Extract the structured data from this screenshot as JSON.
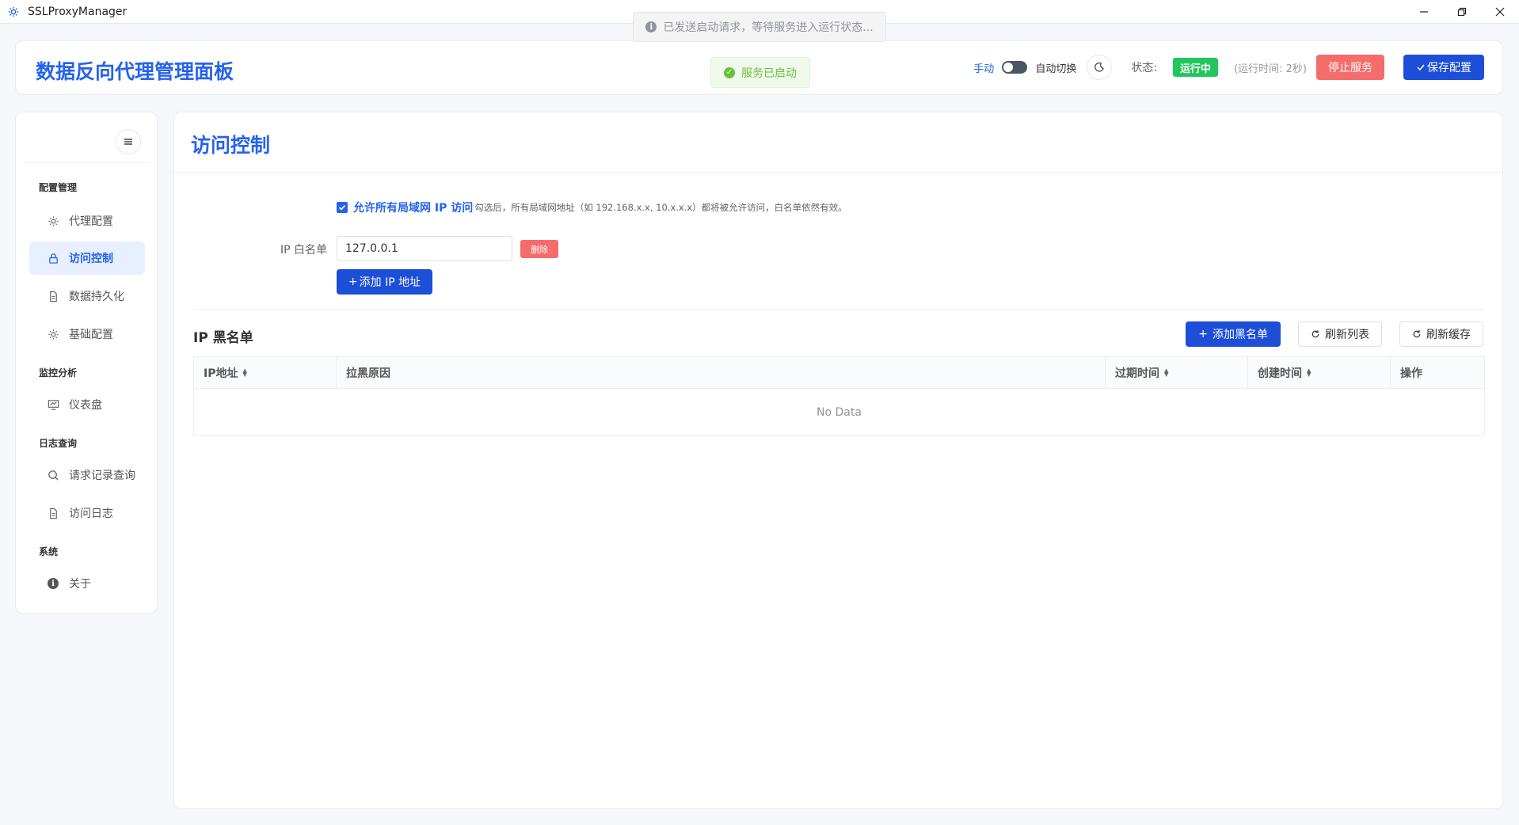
{
  "window": {
    "title": "SSLProxyManager",
    "icon": "gear-icon",
    "controls": [
      "minimize-icon",
      "restore-icon",
      "close-icon"
    ]
  },
  "toasts": {
    "info": "已发送启动请求，等待服务进入运行状态...",
    "success": "服务已启动"
  },
  "header": {
    "title": "数据反向代理管理面板",
    "mode_manual": "手动",
    "mode_auto": "自动切换",
    "status_label": "状态:",
    "status_value": "运行中",
    "uptime": "(运行时间: 2秒)",
    "stop_button": "停止服务",
    "save_button": "保存配置"
  },
  "sidebar": {
    "groups": [
      {
        "title": "配置管理",
        "items": [
          {
            "label": "代理配置",
            "icon": "gear-icon"
          },
          {
            "label": "访问控制",
            "icon": "lock-icon",
            "active": true
          },
          {
            "label": "数据持久化",
            "icon": "document-icon"
          },
          {
            "label": "基础配置",
            "icon": "gear-icon"
          }
        ]
      },
      {
        "title": "监控分析",
        "items": [
          {
            "label": "仪表盘",
            "icon": "dashboard-icon"
          }
        ]
      },
      {
        "title": "日志查询",
        "items": [
          {
            "label": "请求记录查询",
            "icon": "search-icon"
          },
          {
            "label": "访问日志",
            "icon": "document-icon"
          }
        ]
      },
      {
        "title": "系统",
        "items": [
          {
            "label": "关于",
            "icon": "info-icon"
          }
        ]
      }
    ]
  },
  "main": {
    "title": "访问控制",
    "allow_lan": {
      "checked": true,
      "label": "允许所有局域网 IP 访问",
      "hint": "勾选后，所有局域网地址（如 192.168.x.x, 10.x.x.x）都将被允许访问，白名单依然有效。"
    },
    "whitelist": {
      "label": "IP 白名单",
      "entries": [
        "127.0.0.1"
      ],
      "delete_button": "删除",
      "add_button": "添加 IP 地址"
    },
    "blacklist": {
      "title": "IP 黑名单",
      "add_button": "添加黑名单",
      "refresh_list_button": "刷新列表",
      "refresh_cache_button": "刷新缓存",
      "columns": [
        "IP地址",
        "拉黑原因",
        "过期时间",
        "创建时间",
        "操作"
      ],
      "sortable": [
        true,
        false,
        true,
        true,
        false
      ],
      "rows": [],
      "empty_text": "No Data"
    }
  },
  "colors": {
    "primary": "#2563eb",
    "primary_button": "#1d4ed8",
    "danger": "#f56c6c",
    "success": "#22c55e"
  }
}
